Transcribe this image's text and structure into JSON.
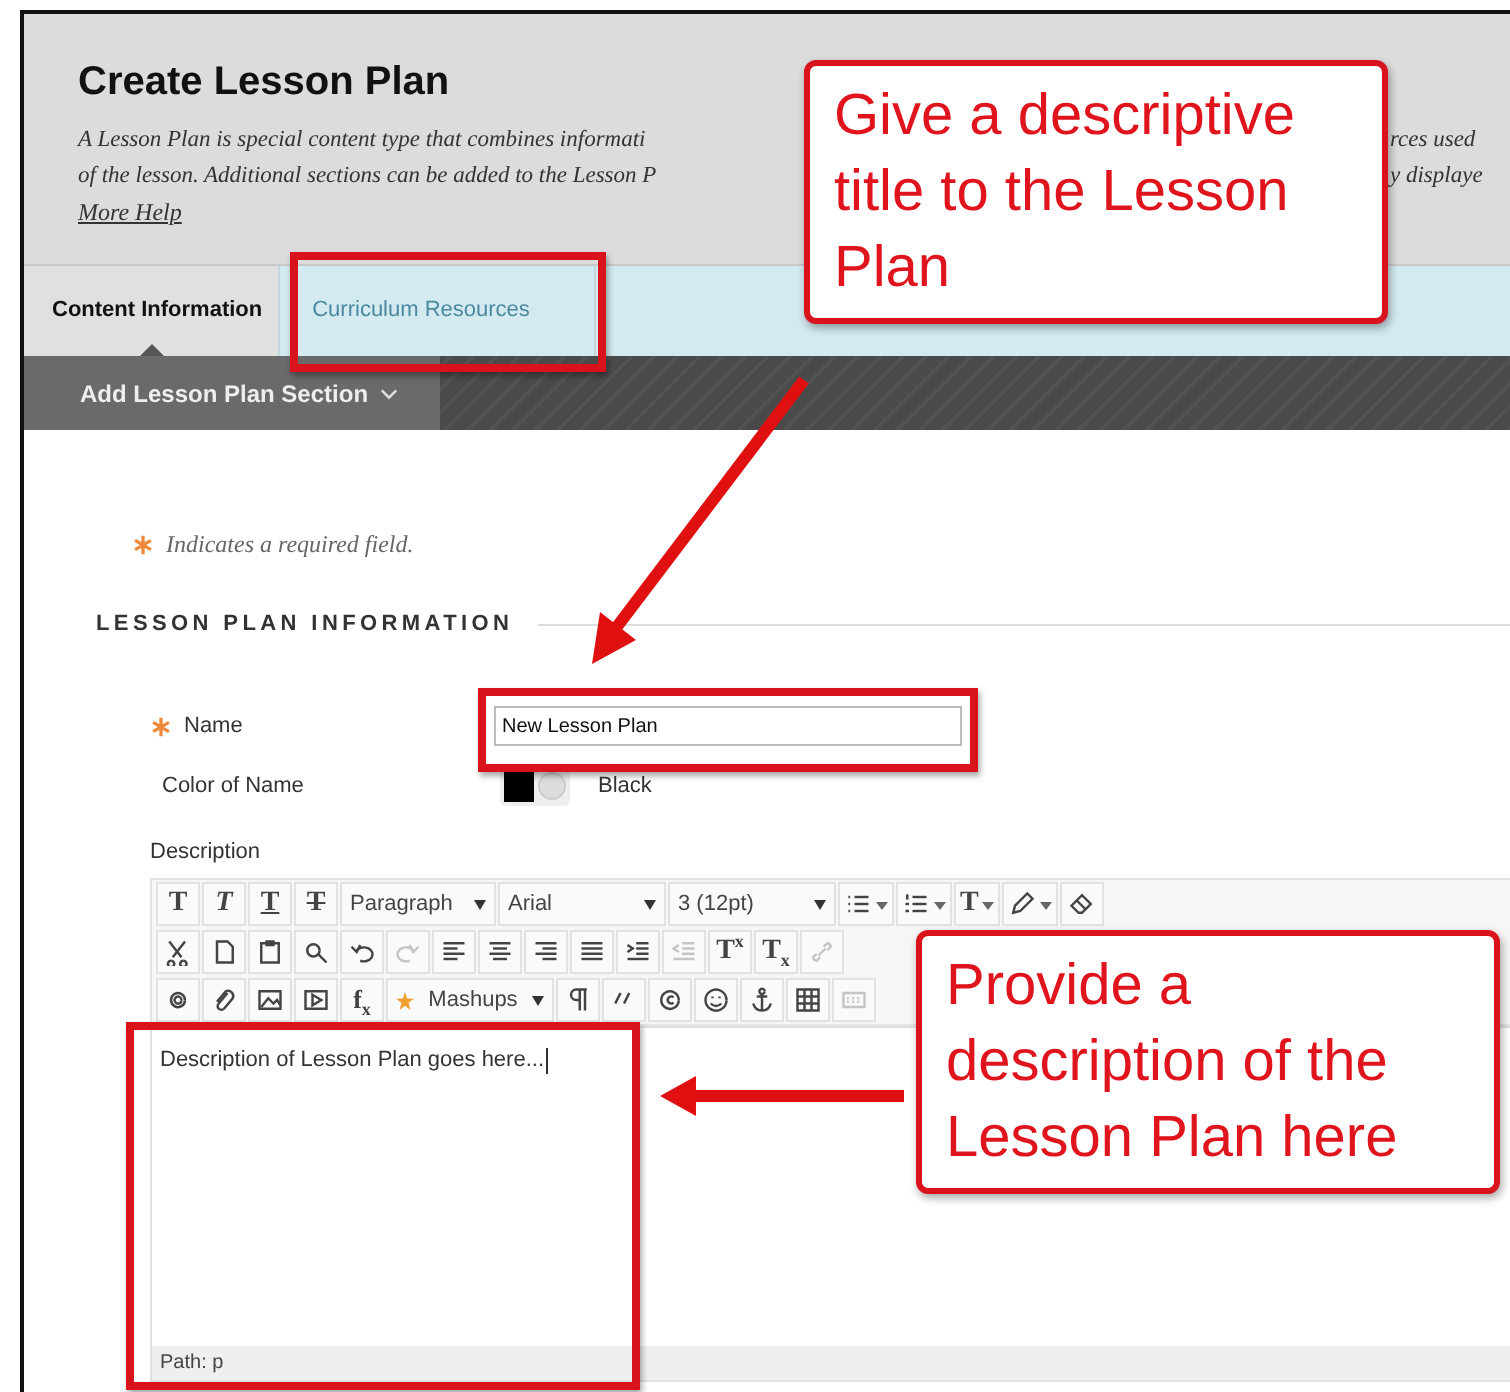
{
  "page": {
    "title": "Create Lesson Plan",
    "intro_lines": [
      {
        "left": "A Lesson Plan is special content type that combines informati",
        "right": "rces used"
      },
      {
        "left": "of the lesson. Additional sections can be added to the Lesson P",
        "right": "y displaye"
      }
    ],
    "more_help": "More Help"
  },
  "tabs": [
    {
      "label": "Content Information",
      "selected": true
    },
    {
      "label": "Curriculum Resources",
      "selected": false
    }
  ],
  "action_bar": {
    "button": "Add Lesson Plan Section"
  },
  "required_note": "Indicates a required field.",
  "section_title": "LESSON PLAN INFORMATION",
  "form": {
    "name_label": "Name",
    "name_value": "New Lesson Plan",
    "color_label": "Color of Name",
    "color_value": "Black",
    "description_label": "Description"
  },
  "toolbar": [
    [
      {
        "kind": "bold",
        "text": "T",
        "disabled": false
      },
      {
        "kind": "italic",
        "text": "T",
        "disabled": false
      },
      {
        "kind": "underline",
        "text": "T",
        "disabled": false
      },
      {
        "kind": "strike",
        "text": "T",
        "disabled": false
      },
      {
        "kind": "select",
        "text": "Paragraph",
        "disabled": false
      },
      {
        "kind": "select",
        "text": "Arial",
        "disabled": false
      },
      {
        "kind": "select",
        "text": "3 (12pt)",
        "disabled": false
      },
      {
        "kind": "bullets",
        "menu": true,
        "disabled": false
      },
      {
        "kind": "numbers",
        "menu": true,
        "disabled": false
      },
      {
        "kind": "color",
        "text": "T",
        "menu": true,
        "disabled": false
      },
      {
        "kind": "pen",
        "menu": true,
        "disabled": false
      },
      {
        "kind": "eraser",
        "disabled": false
      }
    ],
    [
      {
        "kind": "scissors",
        "disabled": false
      },
      {
        "kind": "page",
        "disabled": false
      },
      {
        "kind": "clipboard",
        "disabled": false
      },
      {
        "kind": "search",
        "disabled": false
      },
      {
        "kind": "undo",
        "disabled": false
      },
      {
        "kind": "redo",
        "disabled": true
      },
      {
        "kind": "align-left",
        "disabled": false
      },
      {
        "kind": "align-center",
        "disabled": false
      },
      {
        "kind": "align-right",
        "disabled": false
      },
      {
        "kind": "justify",
        "disabled": false
      },
      {
        "kind": "indent",
        "disabled": false
      },
      {
        "kind": "outdent",
        "disabled": true
      },
      {
        "kind": "superscript",
        "text": "T$^{x}$",
        "disabled": false
      },
      {
        "kind": "subscript",
        "text": "T$_{x}$",
        "disabled": false
      },
      {
        "kind": "link",
        "disabled": true
      }
    ],
    [
      {
        "kind": "record",
        "disabled": false
      },
      {
        "kind": "paperclip",
        "disabled": false
      },
      {
        "kind": "image",
        "disabled": false
      },
      {
        "kind": "media",
        "disabled": false
      },
      {
        "kind": "formula",
        "text": "f$_{x}$",
        "disabled": false
      },
      {
        "kind": "select",
        "text": "Mashups",
        "star": true,
        "disabled": false
      },
      {
        "kind": "pilcrow",
        "disabled": false
      },
      {
        "kind": "quote",
        "disabled": false
      },
      {
        "kind": "copyright",
        "disabled": false
      },
      {
        "kind": "smiley",
        "disabled": false
      },
      {
        "kind": "anchor",
        "disabled": false
      },
      {
        "kind": "table",
        "disabled": false
      },
      {
        "kind": "grid",
        "disabled": true
      }
    ]
  ],
  "editor": {
    "text": "Description of Lesson Plan goes here...",
    "path": "Path: p"
  },
  "callouts": [
    {
      "text": "Give a descriptive\ntitle to the Lesson\nPlan"
    },
    {
      "text": "Provide a\ndescription of the\nLesson Plan here"
    }
  ]
}
